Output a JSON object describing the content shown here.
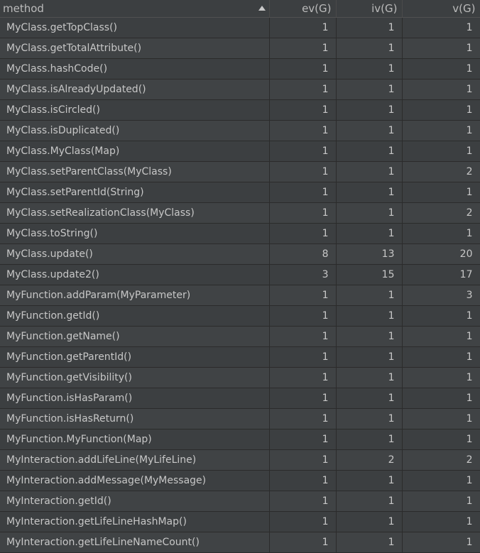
{
  "headers": [
    "method",
    "ev(G)",
    "iv(G)",
    "v(G)"
  ],
  "rows": [
    [
      "MyClass.getTopClass()",
      "1",
      "1",
      "1"
    ],
    [
      "MyClass.getTotalAttribute()",
      "1",
      "1",
      "1"
    ],
    [
      "MyClass.hashCode()",
      "1",
      "1",
      "1"
    ],
    [
      "MyClass.isAlreadyUpdated()",
      "1",
      "1",
      "1"
    ],
    [
      "MyClass.isCircled()",
      "1",
      "1",
      "1"
    ],
    [
      "MyClass.isDuplicated()",
      "1",
      "1",
      "1"
    ],
    [
      "MyClass.MyClass(Map)",
      "1",
      "1",
      "1"
    ],
    [
      "MyClass.setParentClass(MyClass)",
      "1",
      "1",
      "2"
    ],
    [
      "MyClass.setParentId(String)",
      "1",
      "1",
      "1"
    ],
    [
      "MyClass.setRealizationClass(MyClass)",
      "1",
      "1",
      "2"
    ],
    [
      "MyClass.toString()",
      "1",
      "1",
      "1"
    ],
    [
      "MyClass.update()",
      "8",
      "13",
      "20"
    ],
    [
      "MyClass.update2()",
      "3",
      "15",
      "17"
    ],
    [
      "MyFunction.addParam(MyParameter)",
      "1",
      "1",
      "3"
    ],
    [
      "MyFunction.getId()",
      "1",
      "1",
      "1"
    ],
    [
      "MyFunction.getName()",
      "1",
      "1",
      "1"
    ],
    [
      "MyFunction.getParentId()",
      "1",
      "1",
      "1"
    ],
    [
      "MyFunction.getVisibility()",
      "1",
      "1",
      "1"
    ],
    [
      "MyFunction.isHasParam()",
      "1",
      "1",
      "1"
    ],
    [
      "MyFunction.isHasReturn()",
      "1",
      "1",
      "1"
    ],
    [
      "MyFunction.MyFunction(Map)",
      "1",
      "1",
      "1"
    ],
    [
      "MyInteraction.addLifeLine(MyLifeLine)",
      "1",
      "2",
      "2"
    ],
    [
      "MyInteraction.addMessage(MyMessage)",
      "1",
      "1",
      "1"
    ],
    [
      "MyInteraction.getId()",
      "1",
      "1",
      "1"
    ],
    [
      "MyInteraction.getLifeLineHashMap()",
      "1",
      "1",
      "1"
    ],
    [
      "MyInteraction.getLifeLineNameCount()",
      "1",
      "1",
      "1"
    ]
  ],
  "icons": {
    "sort_indicator": "sort-ascending-icon"
  },
  "colors": {
    "background": "#3c3f41",
    "text": "#c7c7c7",
    "grid": "#2b2b2b"
  }
}
